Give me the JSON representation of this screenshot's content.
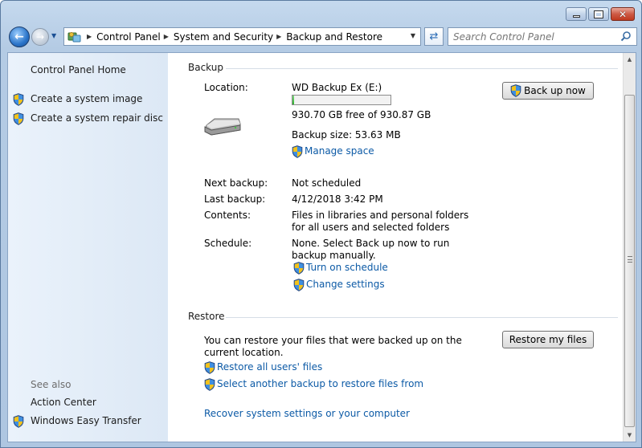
{
  "window": {
    "caption": {
      "minimize": "–",
      "maximize": "□",
      "close": "✕"
    }
  },
  "nav": {
    "back_icon": "back-arrow-icon",
    "forward_icon": "forward-arrow-icon",
    "breadcrumbs": [
      "Control Panel",
      "System and Security",
      "Backup and Restore"
    ],
    "search_placeholder": "Search Control Panel"
  },
  "sidebar": {
    "home": "Control Panel Home",
    "tasks": [
      "Create a system image",
      "Create a system repair disc"
    ],
    "see_also_label": "See also",
    "see_also": [
      "Action Center",
      "Windows Easy Transfer"
    ]
  },
  "backup": {
    "section_title": "Backup",
    "location_label": "Location:",
    "location_value": "WD Backup Ex  (E:)",
    "free_space": "930.70 GB free of 930.87 GB",
    "used_fraction": 0.0002,
    "backup_size": "Backup size: 53.63 MB",
    "manage_space": "Manage space",
    "back_up_now": "Back up now",
    "next_backup_label": "Next backup:",
    "next_backup_value": "Not scheduled",
    "last_backup_label": "Last backup:",
    "last_backup_value": "4/12/2018 3:42 PM",
    "contents_label": "Contents:",
    "contents_value": "Files in libraries and personal folders for all users and selected folders",
    "schedule_label": "Schedule:",
    "schedule_value": "None. Select Back up now to run backup manually.",
    "turn_on_schedule": "Turn on schedule",
    "change_settings": "Change settings"
  },
  "restore": {
    "section_title": "Restore",
    "description": "You can restore your files that were backed up on the current location.",
    "restore_my_files": "Restore my files",
    "restore_all_users": "Restore all users' files",
    "select_another": "Select another backup to restore files from",
    "recover_system": "Recover system settings or your computer"
  },
  "colors": {
    "link": "#0c5aa6",
    "sidebar_bg": "#dce8f5",
    "frame": "#b4cbe4"
  }
}
